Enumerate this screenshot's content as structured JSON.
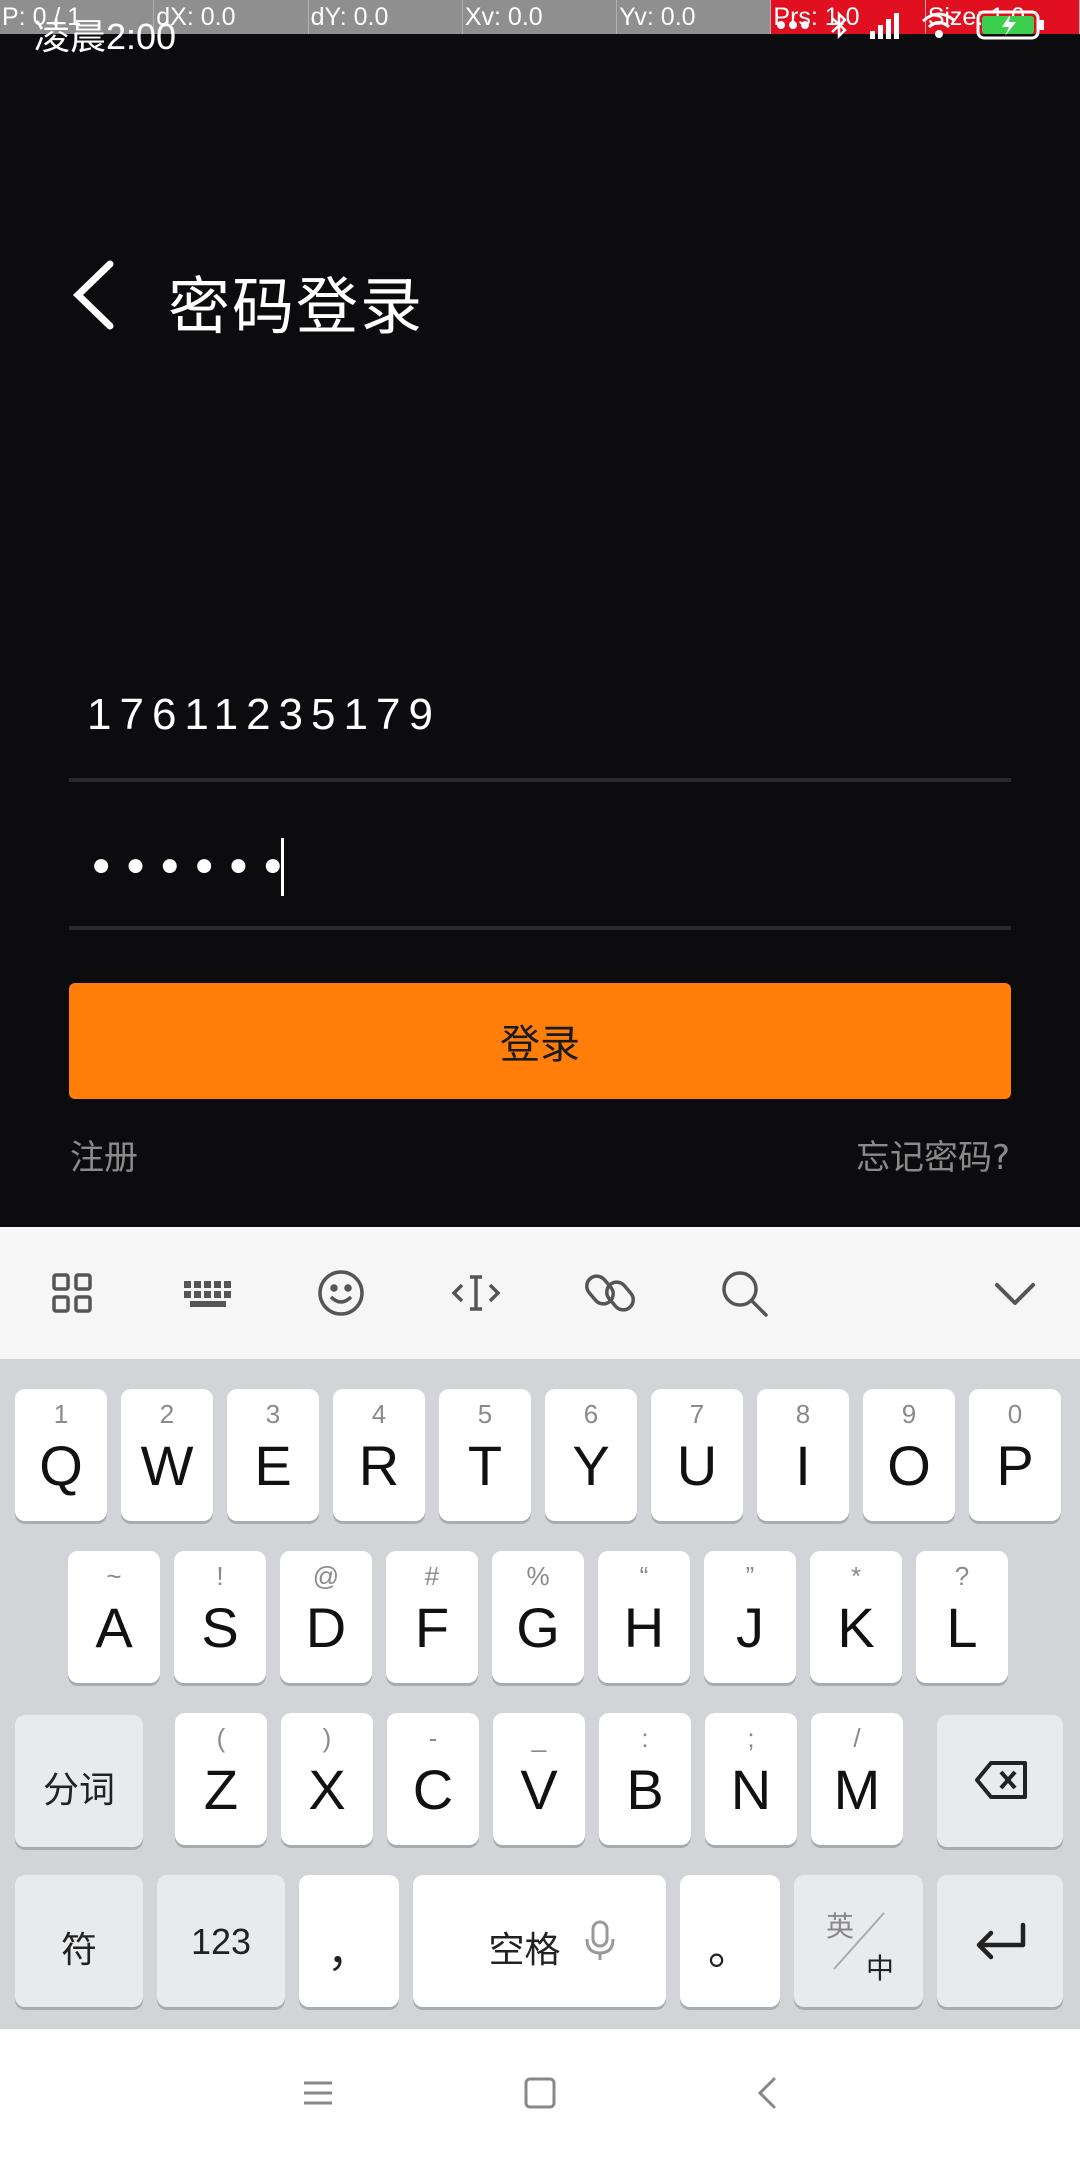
{
  "debug": {
    "cells": [
      "P: 0 / 1",
      "dX: 0.0",
      "dY: 0.0",
      "Xv: 0.0",
      "Yv: 0.0",
      "Prs: 1.0",
      "Size: 1.0"
    ]
  },
  "status": {
    "time": "凌晨2:00"
  },
  "header": {
    "title": "密码登录"
  },
  "form": {
    "phone": "17611235179",
    "password_mask": "••••••",
    "login_label": "登录",
    "register_label": "注册",
    "forgot_label": "忘记密码?"
  },
  "keyboard": {
    "row1": [
      {
        "hint": "1",
        "key": "Q"
      },
      {
        "hint": "2",
        "key": "W"
      },
      {
        "hint": "3",
        "key": "E"
      },
      {
        "hint": "4",
        "key": "R"
      },
      {
        "hint": "5",
        "key": "T"
      },
      {
        "hint": "6",
        "key": "Y"
      },
      {
        "hint": "7",
        "key": "U"
      },
      {
        "hint": "8",
        "key": "I"
      },
      {
        "hint": "9",
        "key": "O"
      },
      {
        "hint": "0",
        "key": "P"
      }
    ],
    "row2": [
      {
        "hint": "~",
        "key": "A"
      },
      {
        "hint": "!",
        "key": "S"
      },
      {
        "hint": "@",
        "key": "D"
      },
      {
        "hint": "#",
        "key": "F"
      },
      {
        "hint": "%",
        "key": "G"
      },
      {
        "hint": "“",
        "key": "H"
      },
      {
        "hint": "”",
        "key": "J"
      },
      {
        "hint": "*",
        "key": "K"
      },
      {
        "hint": "?",
        "key": "L"
      }
    ],
    "row3": [
      {
        "hint": "(",
        "key": "Z"
      },
      {
        "hint": ")",
        "key": "X"
      },
      {
        "hint": "-",
        "key": "C"
      },
      {
        "hint": "_",
        "key": "V"
      },
      {
        "hint": ":",
        "key": "B"
      },
      {
        "hint": ";",
        "key": "N"
      },
      {
        "hint": "/",
        "key": "M"
      }
    ],
    "segment_label": "分词",
    "symbols_label": "符",
    "numbers_label": "123",
    "comma_label": "，",
    "space_label": "空格",
    "period_label": "。",
    "lang_en": "英",
    "lang_zh": "中"
  },
  "colors": {
    "accent": "#ff7e0a",
    "background": "#0c0c0e",
    "keyboard_bg": "#d3d4d8"
  }
}
